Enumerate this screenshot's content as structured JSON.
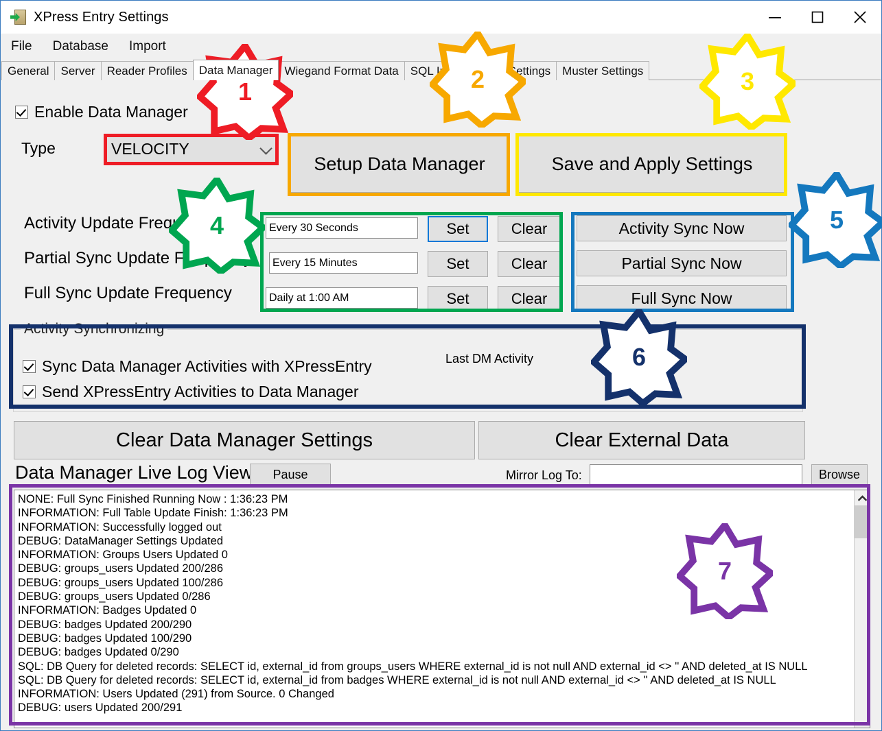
{
  "window": {
    "title": "XPress Entry Settings",
    "icon": "door-exit-icon",
    "minimize": "minimize-icon",
    "maximize": "maximize-icon",
    "close": "close-icon"
  },
  "menu": {
    "items": [
      "File",
      "Database",
      "Import"
    ]
  },
  "tabs": {
    "items": [
      {
        "label": "General",
        "active": false
      },
      {
        "label": "Server",
        "active": false
      },
      {
        "label": "Reader Profiles",
        "active": false
      },
      {
        "label": "Data Manager",
        "active": true
      },
      {
        "label": "Wiegand Format Data",
        "active": false
      },
      {
        "label": "SQL Import",
        "active": false
      },
      {
        "label": "Alert Settings",
        "active": false
      },
      {
        "label": "Muster Settings",
        "active": false
      }
    ]
  },
  "main": {
    "enable_data_manager": {
      "label": "Enable Data Manager",
      "checked": true
    },
    "type_label": "Type",
    "type_value": "VELOCITY",
    "setup_button": "Setup Data Manager",
    "save_button": "Save and Apply Settings",
    "frequencies": [
      {
        "label": "Activity Update Frequency",
        "value": "Every 30 Seconds",
        "set": "Set",
        "clear": "Clear",
        "focused": true
      },
      {
        "label": "Partial Sync Update Frequency",
        "value": "Every 15 Minutes",
        "set": "Set",
        "clear": "Clear",
        "focused": false
      },
      {
        "label": "Full Sync Update Frequency",
        "value": "Daily at 1:00 AM",
        "set": "Set",
        "clear": "Clear",
        "focused": false
      }
    ],
    "sync_now": [
      "Activity Sync Now",
      "Partial Sync Now",
      "Full Sync Now"
    ],
    "activity_group": {
      "title": "Activity Synchronizing",
      "last_dm_activity_label": "Last DM Activity",
      "last_dm_activity_value": "",
      "checkboxes": [
        {
          "label": "Sync Data Manager Activities with XPressEntry",
          "checked": true
        },
        {
          "label": "Send XPressEntry Activities to Data Manager",
          "checked": true
        }
      ]
    },
    "clear_settings_button": "Clear Data Manager Settings",
    "clear_external_button": "Clear External Data",
    "log_title": "Data Manager Live Log View",
    "pause_button": "Pause",
    "mirror_label": "Mirror Log To:",
    "mirror_value": "",
    "mirror_placeholder": "",
    "browse_button": "Browse",
    "log_lines": [
      "NONE: Full Sync Finished Running Now : 1:36:23 PM",
      "INFORMATION: Full Table Update Finish: 1:36:23 PM",
      "INFORMATION: Successfully logged out",
      "DEBUG: DataManager Settings Updated",
      "INFORMATION: Groups Users Updated 0",
      "DEBUG: groups_users Updated 200/286",
      "DEBUG: groups_users Updated 100/286",
      "DEBUG: groups_users Updated 0/286",
      "INFORMATION: Badges Updated 0",
      "DEBUG: badges Updated 200/290",
      "DEBUG: badges Updated 100/290",
      "DEBUG: badges Updated 0/290",
      "SQL: DB Query for deleted records: SELECT id, external_id from groups_users WHERE external_id is not null AND external_id <> '' AND deleted_at IS NULL",
      "SQL: DB Query for deleted records: SELECT id, external_id from badges WHERE external_id is not null AND external_id <> '' AND deleted_at IS NULL",
      "INFORMATION: Users Updated (291) from Source. 0 Changed",
      "DEBUG: users Updated 200/291"
    ]
  },
  "annotations": {
    "callouts": [
      {
        "number": "1",
        "color": "#ee1c25"
      },
      {
        "number": "2",
        "color": "#f7a800"
      },
      {
        "number": "3",
        "color": "#ffe800"
      },
      {
        "number": "4",
        "color": "#00a650"
      },
      {
        "number": "5",
        "color": "#1478be"
      },
      {
        "number": "6",
        "color": "#14316b"
      },
      {
        "number": "7",
        "color": "#7a34a6"
      }
    ]
  }
}
